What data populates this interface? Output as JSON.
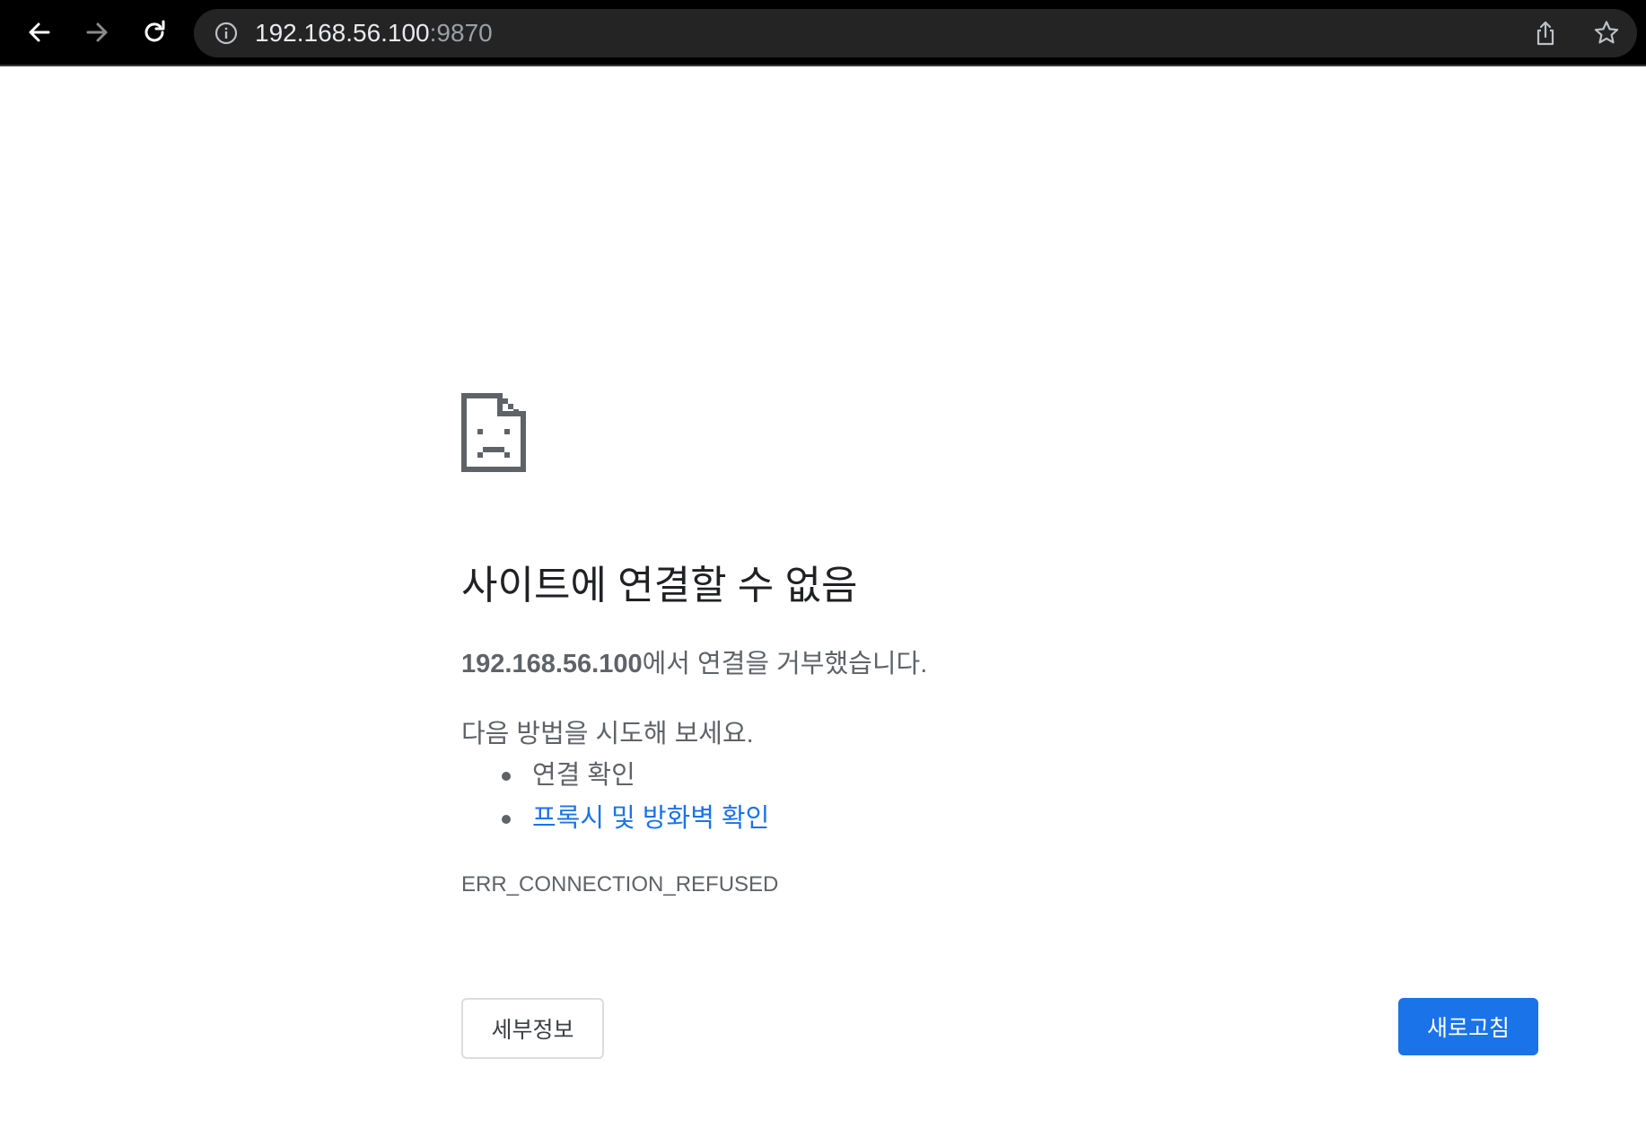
{
  "browser": {
    "url_host": "192.168.56.100",
    "url_port": ":9870",
    "icons": {
      "back": "arrow-left-icon",
      "forward": "arrow-right-icon",
      "reload": "reload-icon",
      "site_info": "info-icon",
      "share": "share-icon",
      "bookmark": "star-icon"
    },
    "colors": {
      "toolbar_bg": "#000000",
      "omnibox_bg": "#242424"
    }
  },
  "error_page": {
    "icon": "sad-page-icon",
    "headline": "사이트에 연결할 수 없음",
    "summary_host": "192.168.56.100",
    "summary_text": "에서 연결을 거부했습니다.",
    "suggestions_title": "다음 방법을 시도해 보세요.",
    "suggestions": [
      {
        "label": "연결 확인",
        "is_link": false
      },
      {
        "label": "프록시 및 방화벽 확인",
        "is_link": true
      }
    ],
    "error_code": "ERR_CONNECTION_REFUSED",
    "details_button": "세부정보",
    "reload_button": "새로고침",
    "colors": {
      "primary": "#1a73e8",
      "text": "#5f6368",
      "headline": "#202124"
    }
  }
}
